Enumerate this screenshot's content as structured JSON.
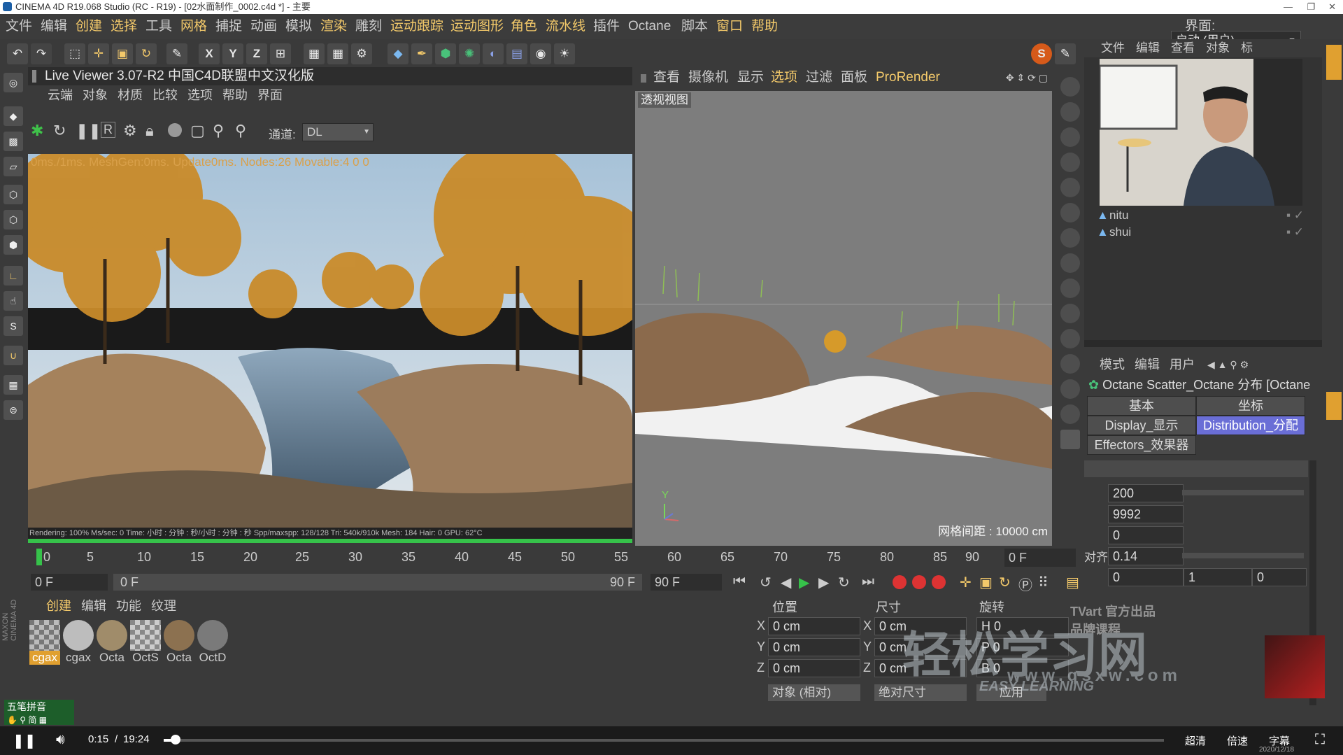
{
  "app": {
    "title": "CINEMA 4D R19.068 Studio (RC - R19) - [02水面制作_0002.c4d *] - 主要"
  },
  "menubar": {
    "items": [
      "文件",
      "编辑",
      "创建",
      "选择",
      "工具",
      "网格",
      "捕捉",
      "动画",
      "模拟",
      "渲染",
      "雕刻",
      "运动跟踪",
      "运动图形",
      "角色",
      "流水线",
      "插件",
      "Octane",
      "脚本",
      "窗口",
      "帮助"
    ],
    "layout_label": "界面:",
    "layout_value": "启动 (用户)"
  },
  "live_viewer": {
    "title": "Live Viewer 3.07-R2 中国C4D联盟中文汉化版",
    "menu": [
      "云端",
      "对象",
      "材质",
      "比较",
      "选项",
      "帮助",
      "界面"
    ],
    "channel_label": "通道:",
    "channel_value": "DL",
    "overlay_text": "0ms./1ms. MeshGen:0ms. Update0ms. Nodes:26 Movable:4  0 0",
    "stats": "Rendering: 100%    Ms/sec: 0   Time: 小时 : 分钟 : 秒/小时 : 分钟 : 秒   Spp/maxspp: 128/128    Tri: 540k/910k    Mesh: 184  Hair: 0    GPU:  62°C"
  },
  "viewport": {
    "menu": [
      "查看",
      "摄像机",
      "显示",
      "选项",
      "过滤",
      "面板",
      "ProRender"
    ],
    "label": "透视视图",
    "grid_info": "网格间距 : 10000 cm"
  },
  "object_manager": {
    "menu": [
      "文件",
      "编辑",
      "查看",
      "对象",
      "标"
    ],
    "objects": [
      "nitu",
      "shui"
    ]
  },
  "attributes": {
    "menu": [
      "模式",
      "编辑",
      "用户"
    ],
    "object_title": "Octane Scatter_Octane 分布 [Octane",
    "tabs": [
      "基本",
      "坐标",
      "Display_显示",
      "Distribution_分配",
      "Effectors_效果器"
    ],
    "values": [
      "200",
      "9992",
      "0",
      "0.14",
      "0",
      "1",
      "0"
    ],
    "row_labels": [
      "对齐"
    ]
  },
  "timeline": {
    "ticks": [
      "0",
      "5",
      "10",
      "15",
      "20",
      "25",
      "30",
      "35",
      "40",
      "45",
      "50",
      "55",
      "60",
      "65",
      "70",
      "75",
      "80",
      "85",
      "90"
    ],
    "frame_display": "0 F",
    "start_frame": "0 F",
    "range_start": "0 F",
    "range_end": "90 F",
    "end_frame": "90 F"
  },
  "material_manager": {
    "menu": [
      "创建",
      "编辑",
      "功能",
      "纹理"
    ],
    "materials": [
      "cgax",
      "cgax",
      "Octa",
      "OctS",
      "Octa",
      "OctD"
    ]
  },
  "coordinates": {
    "headers": [
      "位置",
      "尺寸",
      "旋转"
    ],
    "axes": [
      "X",
      "Y",
      "Z"
    ],
    "position": [
      "0 cm",
      "0 cm",
      "0 cm"
    ],
    "size": [
      "0 cm",
      "0 cm",
      "0 cm"
    ],
    "rotation": [
      "H 0",
      "P 0",
      "B 0"
    ],
    "mode_select": "对象 (相对)",
    "size_select": "绝对尺寸",
    "apply_button": "应用"
  },
  "ime": {
    "label": "五笔拼音"
  },
  "player": {
    "current_time": "0:15",
    "separator": "/",
    "total_time": "19:24",
    "quality": "超清",
    "speed": "倍速",
    "subtitle": "字幕",
    "date": "2020/12/18"
  },
  "watermark": {
    "brand": "TVart 官方出品品牌课程",
    "main": "轻松学习网",
    "sub": "EASY LEARNING",
    "url": "www.qsxw.com"
  },
  "colors": {
    "accent": "#f3c96a",
    "selected_tab": "#6a6ed6",
    "green_bar": "#36c24a"
  }
}
